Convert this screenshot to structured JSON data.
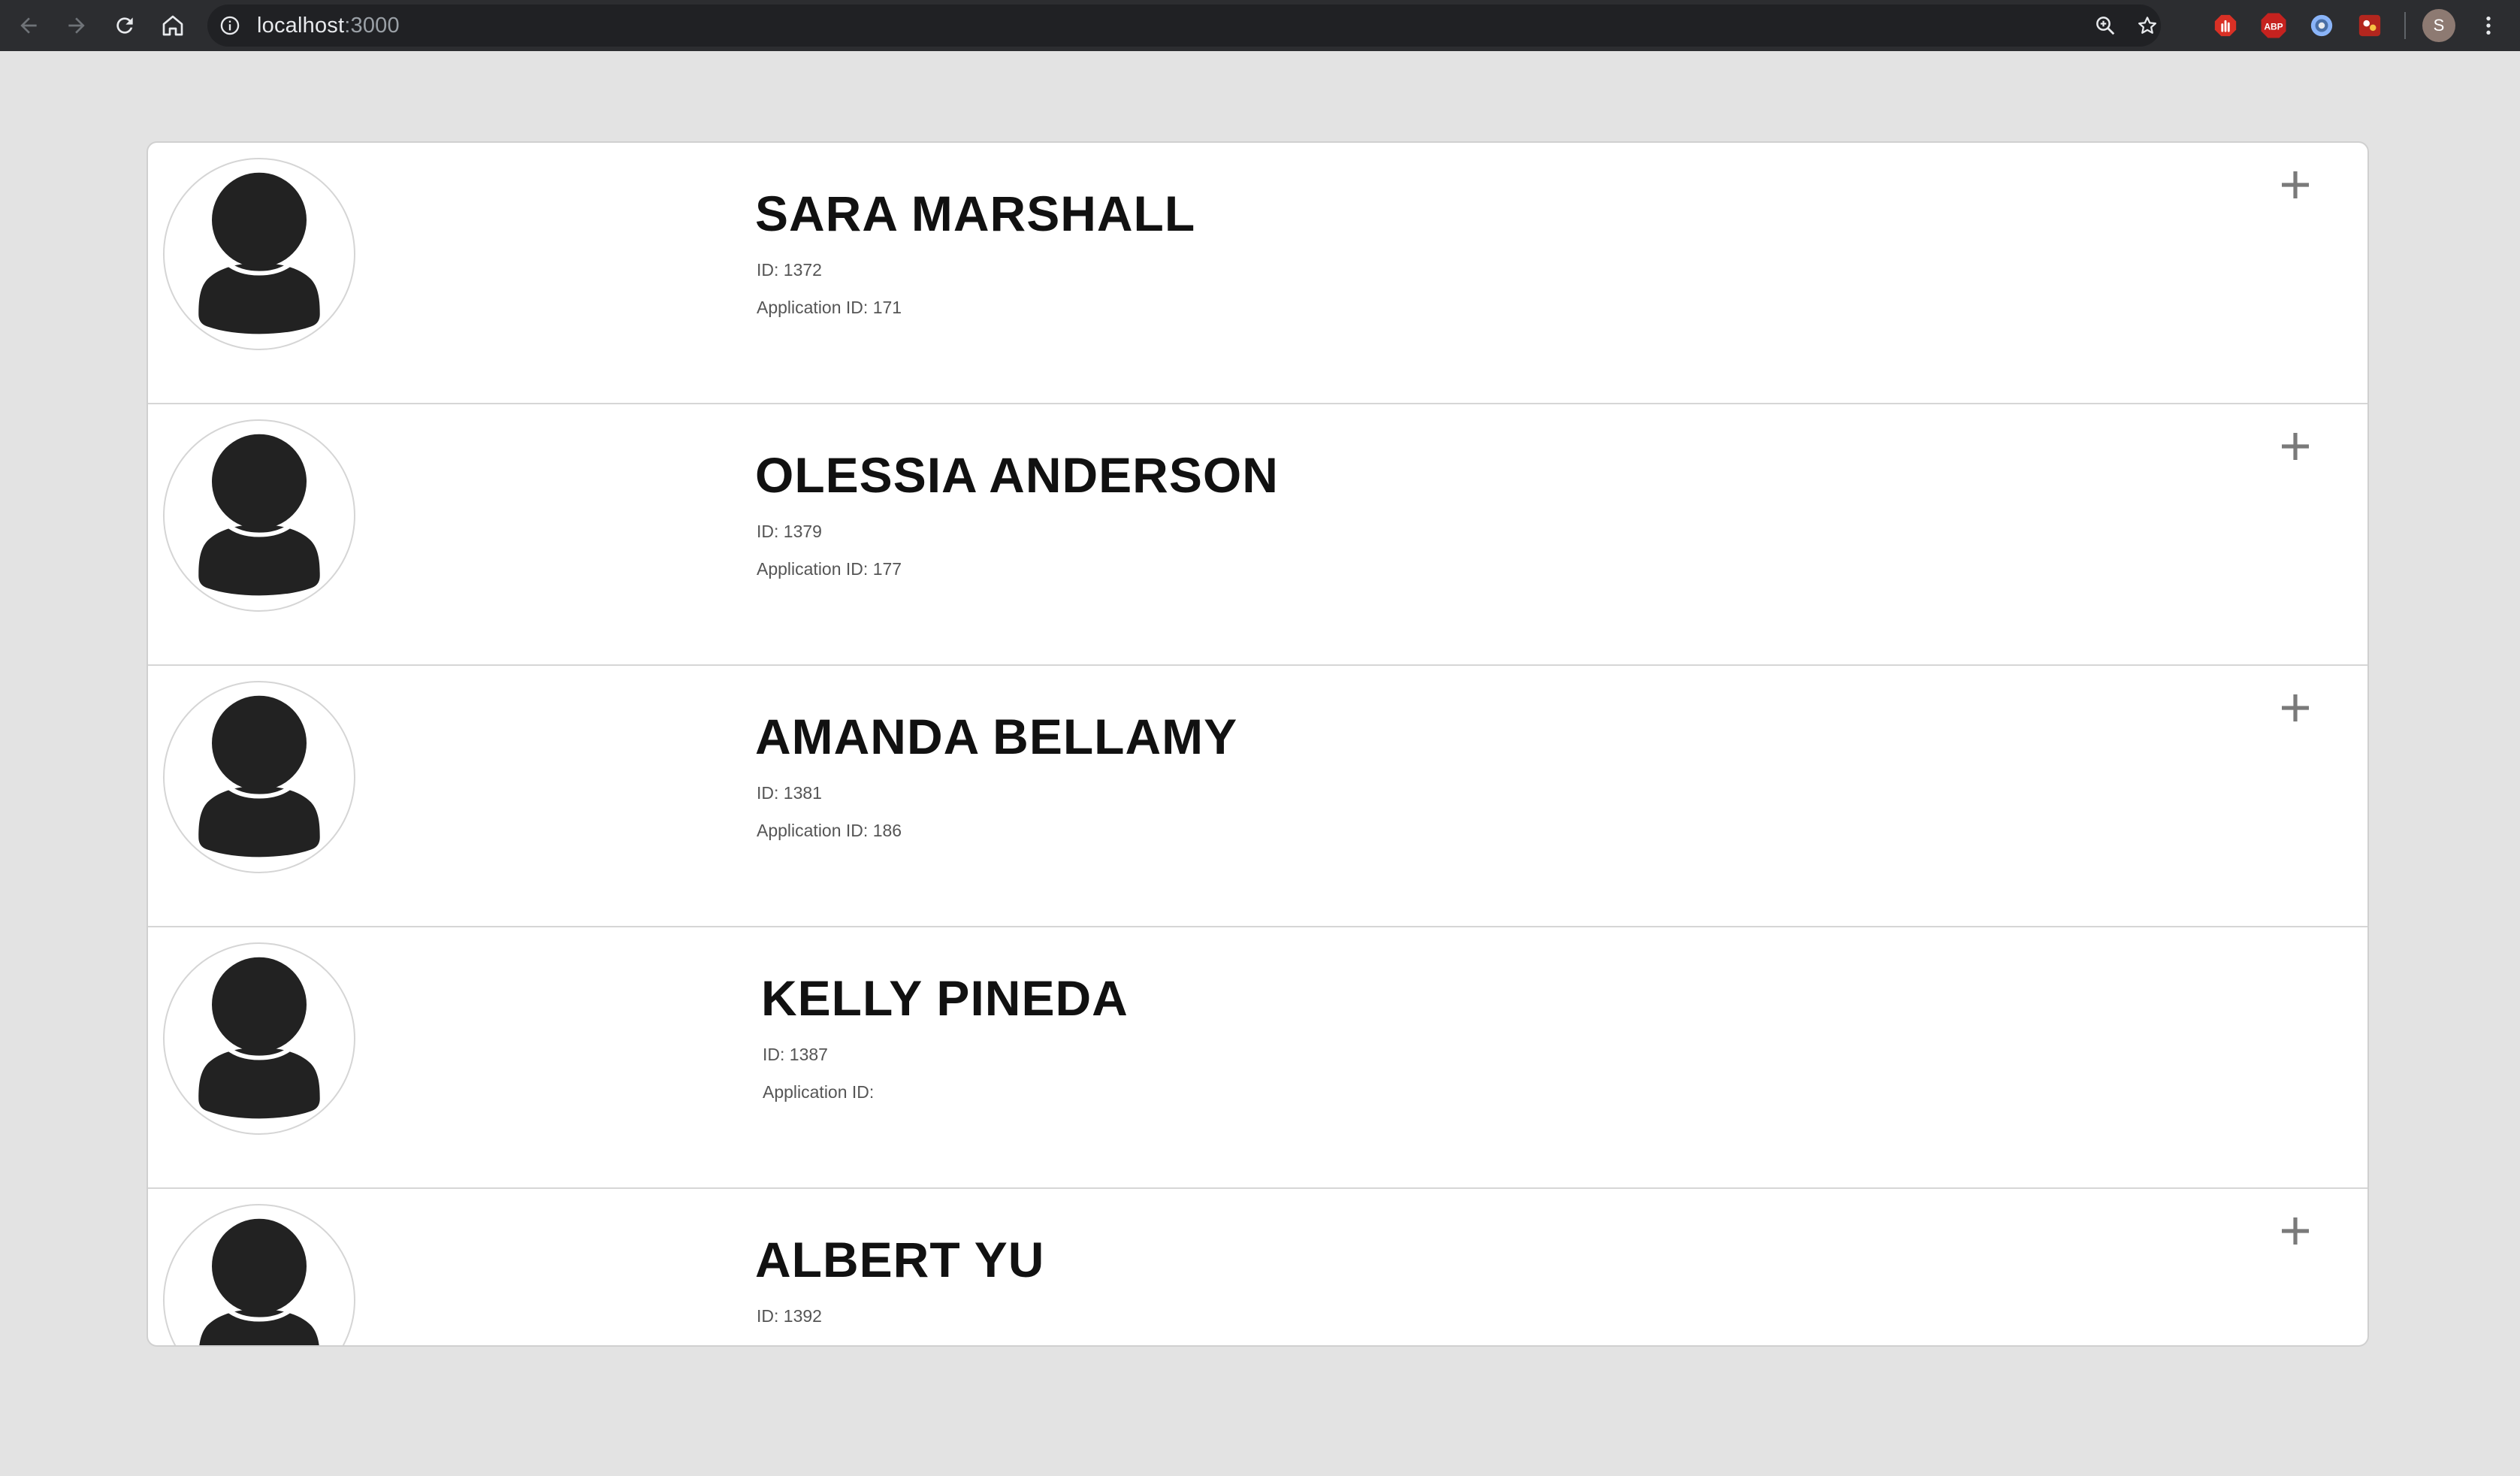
{
  "browser": {
    "url_host": "localhost",
    "url_port": ":3000",
    "profile_initial": "S",
    "extensions": [
      {
        "name": "stop-extension",
        "label": "",
        "color": "#d93025"
      },
      {
        "name": "adblock-plus-extension",
        "label": "ABP",
        "color": "#c5221f"
      },
      {
        "name": "blue-circle-extension",
        "label": "",
        "color": "#4a6fa5"
      },
      {
        "name": "red-square-extension",
        "label": "",
        "color": "#b3261e"
      }
    ]
  },
  "applicants": [
    {
      "name": "SARA MARSHALL",
      "id_text": "ID: 1372",
      "app_text": "Application ID: 171",
      "has_add": true
    },
    {
      "name": "OLESSIA ANDERSON",
      "id_text": "ID: 1379",
      "app_text": "Application ID: 177",
      "has_add": true
    },
    {
      "name": "AMANDA BELLAMY",
      "id_text": "ID: 1381",
      "app_text": "Application ID: 186",
      "has_add": true
    },
    {
      "name": "KELLY PINEDA",
      "id_text": "ID: 1387",
      "app_text": "Application ID:",
      "has_add": false
    },
    {
      "name": "ALBERT YU",
      "id_text": "ID: 1392",
      "app_text": "",
      "has_add": true
    }
  ],
  "colors": {
    "page_bg": "#e3e3e3",
    "card_bg": "#ffffff",
    "avatar_fill": "#222222",
    "plus_color": "#7a7a7a"
  },
  "icons": {
    "back": "back-arrow-icon",
    "forward": "forward-arrow-icon",
    "reload": "reload-icon",
    "home": "home-icon",
    "info": "info-icon",
    "zoom": "zoom-icon",
    "bookmark": "star-icon",
    "menu": "kebab-menu-icon",
    "add": "plus-icon",
    "avatar": "user-silhouette-icon"
  }
}
